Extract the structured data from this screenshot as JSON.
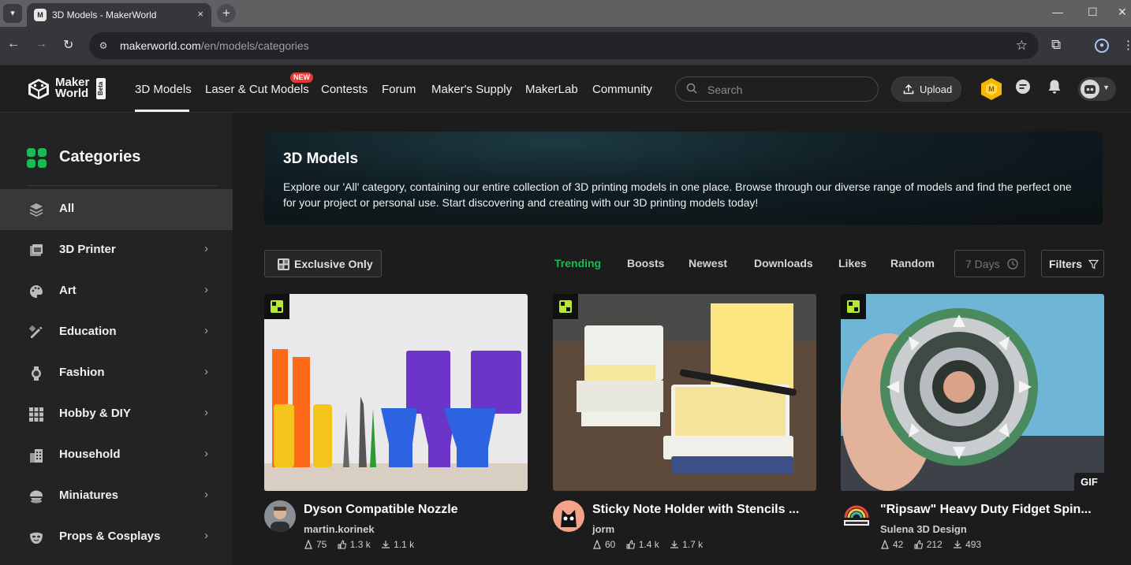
{
  "browser": {
    "tab_title": "3D Models - MakerWorld",
    "tab_menu_icon": "chevron-down-icon",
    "close_icon": "×",
    "new_tab": "+",
    "url_host": "makerworld.com",
    "url_path": "/en/models/categories",
    "window_controls": [
      "—",
      "☐",
      "✕"
    ]
  },
  "header": {
    "logo_line1": "Maker",
    "logo_line2": "World",
    "logo_beta": "Beta",
    "nav": [
      "3D Models",
      "Laser & Cut Models",
      "Contests",
      "Forum",
      "Maker's Supply",
      "MakerLab",
      "Community"
    ],
    "new_badge": "NEW",
    "search_placeholder": "Search",
    "upload_label": "Upload"
  },
  "sidebar": {
    "title": "Categories",
    "items": [
      {
        "label": "All",
        "icon": "layers-icon"
      },
      {
        "label": "3D Printer",
        "icon": "printer-icon"
      },
      {
        "label": "Art",
        "icon": "palette-icon"
      },
      {
        "label": "Education",
        "icon": "pencil-ruler-icon"
      },
      {
        "label": "Fashion",
        "icon": "watch-icon"
      },
      {
        "label": "Hobby & DIY",
        "icon": "grid-icon"
      },
      {
        "label": "Household",
        "icon": "building-icon"
      },
      {
        "label": "Miniatures",
        "icon": "miniature-icon"
      },
      {
        "label": "Props & Cosplays",
        "icon": "mask-icon"
      }
    ]
  },
  "banner": {
    "title": "3D Models",
    "description": "Explore our 'All' category, containing our entire collection of 3D printing models in one place. Browse through our diverse range of models and find the perfect one for your project or personal use. Start discovering and creating with our 3D printing models today!"
  },
  "filters": {
    "exclusive_label": "Exclusive Only",
    "sort_tabs": [
      "Trending",
      "Boosts",
      "Newest",
      "Downloads",
      "Likes",
      "Random"
    ],
    "active_sort": "Trending",
    "days_label": "7 Days",
    "filters_label": "Filters"
  },
  "cards": [
    {
      "title": "Dyson Compatible Nozzle",
      "author": "martin.korinek",
      "boosts": "75",
      "likes": "1.3 k",
      "downloads": "1.1 k",
      "gif": ""
    },
    {
      "title": "Sticky Note Holder with Stencils ...",
      "author": "jorm",
      "boosts": "60",
      "likes": "1.4 k",
      "downloads": "1.7 k",
      "gif": ""
    },
    {
      "title": "\"Ripsaw\" Heavy Duty Fidget Spin...",
      "author": "Sulena 3D Design",
      "boosts": "42",
      "likes": "212",
      "downloads": "493",
      "gif": "GIF"
    }
  ],
  "colors": {
    "accent": "#1db954",
    "new_badge": "#e53935"
  }
}
